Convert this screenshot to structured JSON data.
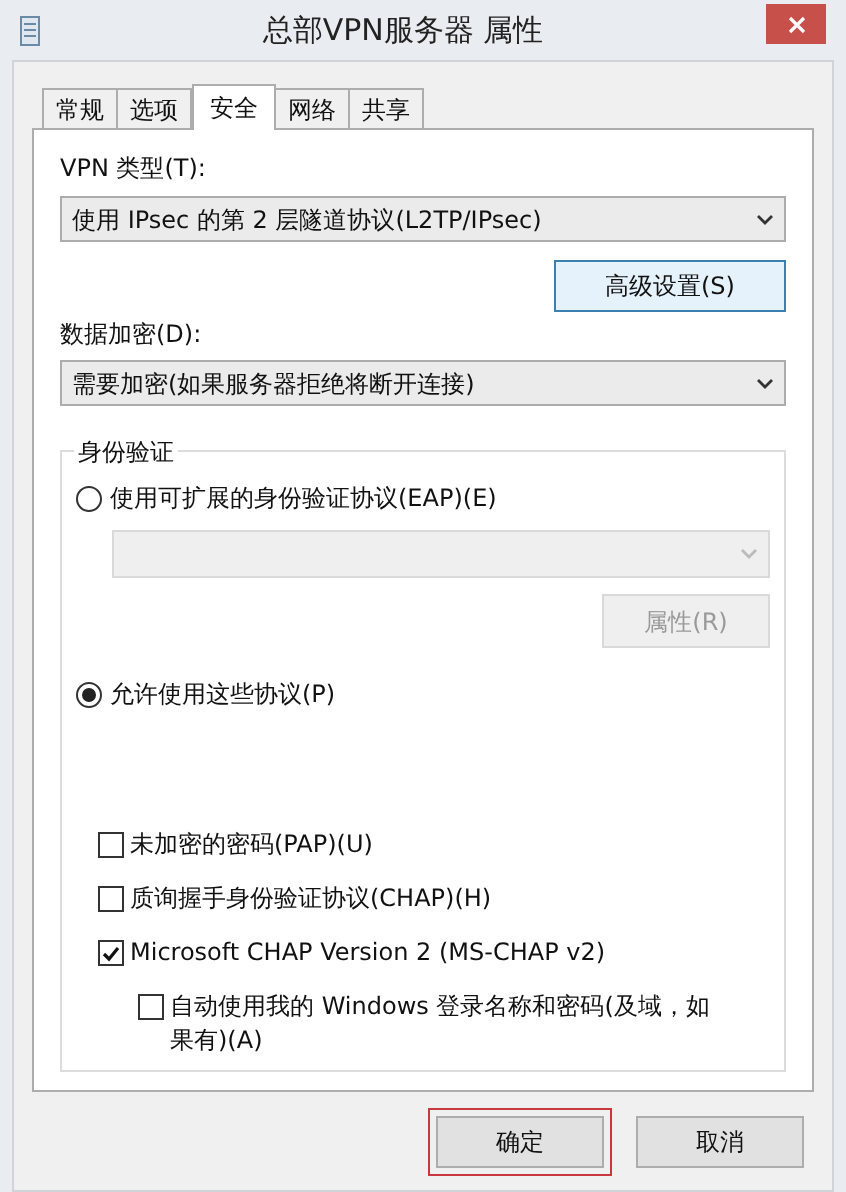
{
  "window": {
    "title": "总部VPN服务器 属性"
  },
  "tabs": [
    {
      "label": "常规",
      "selected": false
    },
    {
      "label": "选项",
      "selected": false
    },
    {
      "label": "安全",
      "selected": true
    },
    {
      "label": "网络",
      "selected": false
    },
    {
      "label": "共享",
      "selected": false
    }
  ],
  "vpn_type": {
    "label": "VPN 类型(T):",
    "value": "使用 IPsec 的第 2 层隧道协议(L2TP/IPsec)"
  },
  "advanced_button": {
    "label": "高级设置(S)"
  },
  "encryption": {
    "label": "数据加密(D):",
    "value": "需要加密(如果服务器拒绝将断开连接)"
  },
  "authentication": {
    "title": "身份验证",
    "eap": {
      "label": "使用可扩展的身份验证协议(EAP)(E)",
      "selected": false,
      "properties_button": {
        "label": "属性(R)",
        "disabled": true
      },
      "dropdown_disabled": true
    },
    "protocols": {
      "label": "允许使用这些协议(P)",
      "selected": true
    },
    "options": [
      {
        "label": "未加密的密码(PAP)(U)",
        "checked": false
      },
      {
        "label": "质询握手身份验证协议(CHAP)(H)",
        "checked": false
      },
      {
        "label": "Microsoft CHAP Version 2 (MS-CHAP v2)",
        "checked": true,
        "children": [
          {
            "label": "自动使用我的 Windows 登录名称和密码(及域，如果有)(A)",
            "checked": false
          }
        ]
      }
    ]
  },
  "buttons": [
    {
      "label": "确定",
      "highlighted": true
    },
    {
      "label": "取消",
      "highlighted": false
    }
  ]
}
